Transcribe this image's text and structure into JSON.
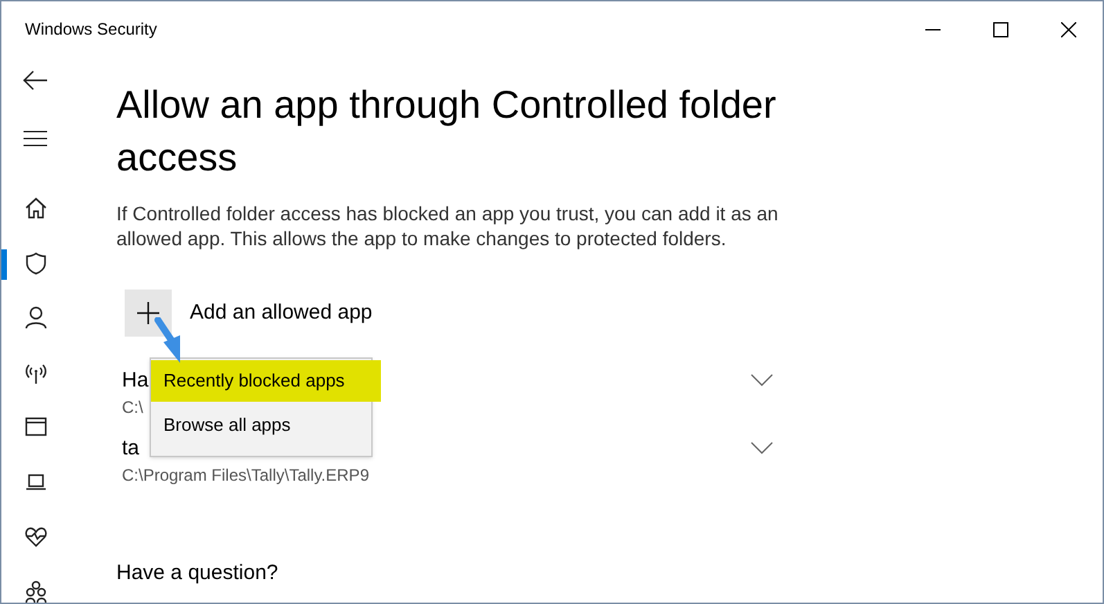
{
  "window": {
    "title": "Windows Security"
  },
  "sidebar": {
    "items": [
      {
        "selected": false
      },
      {
        "selected": true
      },
      {
        "selected": false
      },
      {
        "selected": false
      },
      {
        "selected": false
      },
      {
        "selected": false
      },
      {
        "selected": false
      },
      {
        "selected": false
      }
    ]
  },
  "heading": "Allow an app through Controlled folder access",
  "description": "If Controlled folder access has blocked an app you trust, you can add it as an allowed app. This allows the app to make changes to protected folders.",
  "add_button": {
    "label": "Add an allowed app"
  },
  "apps": [
    {
      "name": "Ha",
      "path": "C:\\"
    },
    {
      "name": "ta",
      "path": "C:\\Program Files\\Tally\\Tally.ERP9"
    }
  ],
  "menu": {
    "items": [
      {
        "label": "Recently blocked apps",
        "selected": true
      },
      {
        "label": "Browse all apps",
        "selected": false
      }
    ]
  },
  "help": {
    "heading": "Have a question?"
  }
}
